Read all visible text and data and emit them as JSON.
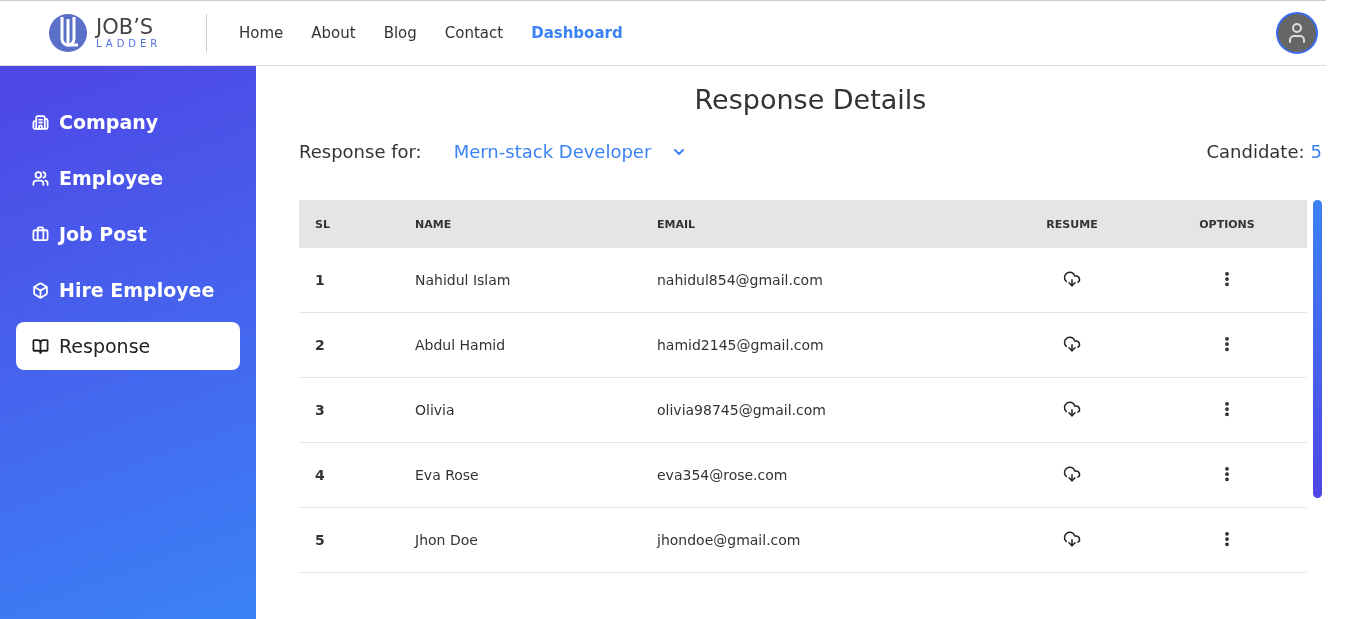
{
  "logo": {
    "title": "JOB’S",
    "subtitle": "LADDER"
  },
  "nav": [
    {
      "label": "Home",
      "selected": false
    },
    {
      "label": "About",
      "selected": false
    },
    {
      "label": "Blog",
      "selected": false
    },
    {
      "label": "Contact",
      "selected": false
    },
    {
      "label": "Dashboard",
      "selected": true
    }
  ],
  "sidebar": {
    "items": [
      {
        "label": "Company",
        "selected": false
      },
      {
        "label": "Employee",
        "selected": false
      },
      {
        "label": "Job Post",
        "selected": false
      },
      {
        "label": "Hire Employee",
        "selected": false
      },
      {
        "label": "Response",
        "selected": true
      }
    ]
  },
  "page_title": "Response Details",
  "filter": {
    "label": "Response for:",
    "value": "Mern-stack Developer"
  },
  "candidate": {
    "label": "Candidate:",
    "count": "5"
  },
  "table": {
    "columns": [
      "SL",
      "NAME",
      "EMAIL",
      "RESUME",
      "OPTIONS"
    ],
    "rows": [
      {
        "sl": "1",
        "name": "Nahidul Islam",
        "email": "nahidul854@gmail.com"
      },
      {
        "sl": "2",
        "name": "Abdul Hamid",
        "email": "hamid2145@gmail.com"
      },
      {
        "sl": "3",
        "name": "Olivia",
        "email": "olivia98745@gmail.com"
      },
      {
        "sl": "4",
        "name": "Eva Rose",
        "email": "eva354@rose.com"
      },
      {
        "sl": "5",
        "name": "Jhon Doe",
        "email": "jhondoe@gmail.com"
      }
    ]
  }
}
